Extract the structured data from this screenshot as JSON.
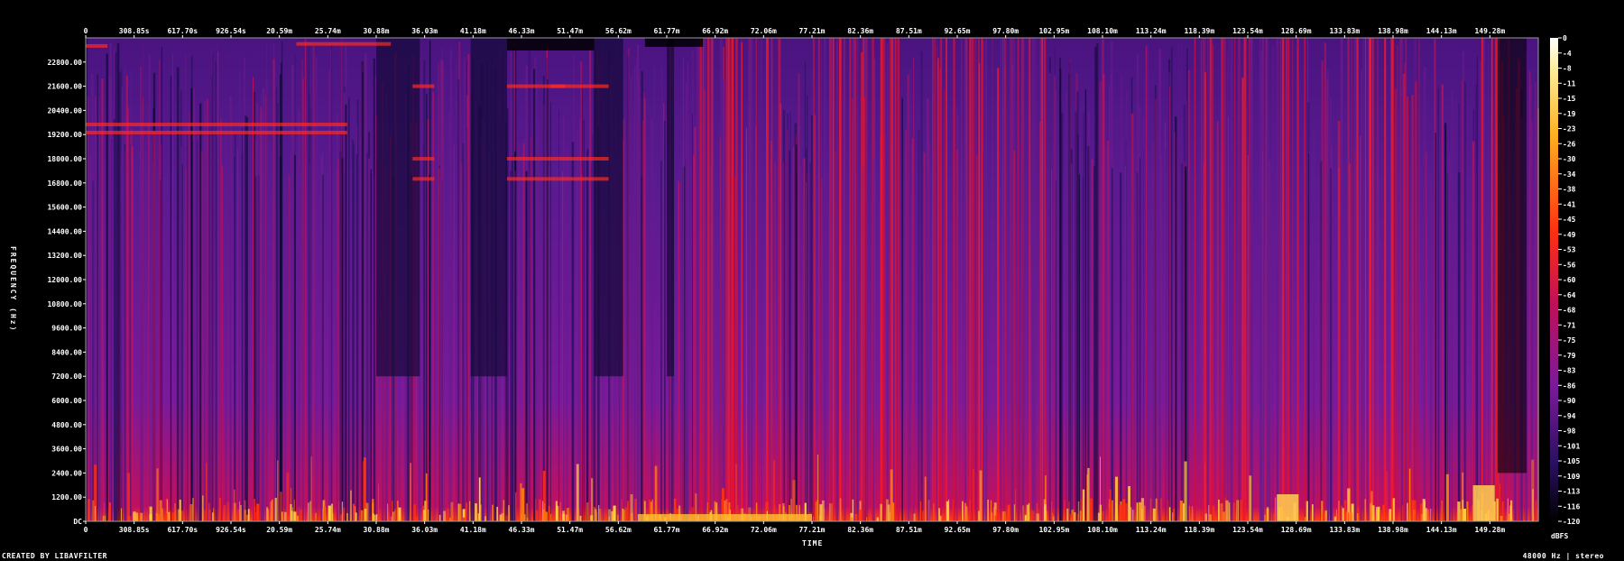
{
  "chart_data": {
    "type": "heatmap",
    "xlabel": "TIME",
    "ylabel": "FREQUENCY (Hz)",
    "colorbar_label": "dBFS",
    "x_ticks": [
      "0",
      "308.85s",
      "617.70s",
      "926.54s",
      "20.59m",
      "25.74m",
      "30.88m",
      "36.03m",
      "41.18m",
      "46.33m",
      "51.47m",
      "56.62m",
      "61.77m",
      "66.92m",
      "72.06m",
      "77.21m",
      "82.36m",
      "87.51m",
      "92.65m",
      "97.80m",
      "102.95m",
      "108.10m",
      "113.24m",
      "118.39m",
      "123.54m",
      "128.69m",
      "133.83m",
      "138.98m",
      "144.13m",
      "149.28m"
    ],
    "y_ticks": [
      "DC",
      "1200.00",
      "2400.00",
      "3600.00",
      "4800.00",
      "6000.00",
      "7200.00",
      "8400.00",
      "9600.00",
      "10800.00",
      "12000.00",
      "13200.00",
      "14400.00",
      "15600.00",
      "16800.00",
      "18000.00",
      "19200.00",
      "20400.00",
      "21600.00",
      "22800.00"
    ],
    "y_tick_values": [
      0,
      1200,
      2400,
      3600,
      4800,
      6000,
      7200,
      8400,
      9600,
      10800,
      12000,
      13200,
      14400,
      15600,
      16800,
      18000,
      19200,
      20400,
      21600,
      22800
    ],
    "ylim": [
      0,
      24000
    ],
    "colorbar_ticks": [
      "0",
      "-4",
      "-8",
      "-11",
      "-15",
      "-19",
      "-23",
      "-26",
      "-30",
      "-34",
      "-38",
      "-41",
      "-45",
      "-49",
      "-53",
      "-56",
      "-60",
      "-64",
      "-68",
      "-71",
      "-75",
      "-79",
      "-83",
      "-86",
      "-90",
      "-94",
      "-98",
      "-101",
      "-105",
      "-109",
      "-113",
      "-116",
      "-120"
    ],
    "colorbar_range": [
      0,
      -120
    ],
    "colors": {
      "background": "#000000",
      "low": "#1a0a4a",
      "mid_low": "#4a1a8a",
      "mid": "#8a1a9a",
      "mid_high": "#e01020",
      "high": "#ff5a10",
      "peak": "#ffe060"
    },
    "grid": false
  },
  "footer": {
    "credit": "CREATED BY LIBAVFILTER",
    "format": "48000 Hz | stereo"
  }
}
